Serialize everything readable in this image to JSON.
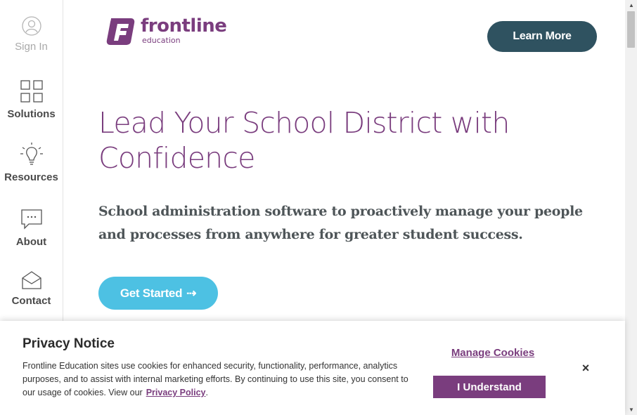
{
  "sidebar": {
    "items": [
      {
        "label": "Sign In",
        "icon": "user-icon"
      },
      {
        "label": "Solutions",
        "icon": "grid-icon"
      },
      {
        "label": "Resources",
        "icon": "lightbulb-icon"
      },
      {
        "label": "About",
        "icon": "chat-icon"
      },
      {
        "label": "Contact",
        "icon": "envelope-icon"
      }
    ]
  },
  "header": {
    "logo_word": "frontline",
    "logo_sub": "education",
    "learn_more": "Learn More"
  },
  "hero": {
    "title": "Lead Your School District with Confidence",
    "subtitle": "School administration software to proactively manage your people and processes from anywhere for greater student success.",
    "cta": "Get Started",
    "cta_arrow": "⇢"
  },
  "privacy": {
    "title": "Privacy Notice",
    "body": "Frontline Education sites use cookies for enhanced security, functionality, performance, analytics purposes, and to assist with internal marketing efforts. By continuing to use this site, you consent to our usage of cookies. View our",
    "link": "Privacy Policy",
    "link_suffix": ".",
    "manage": "Manage Cookies",
    "accept": "I Understand",
    "close": "×"
  },
  "colors": {
    "brand_purple": "#7a3d7e",
    "dark_teal": "#2f5260",
    "cyan": "#4dc1e3"
  }
}
